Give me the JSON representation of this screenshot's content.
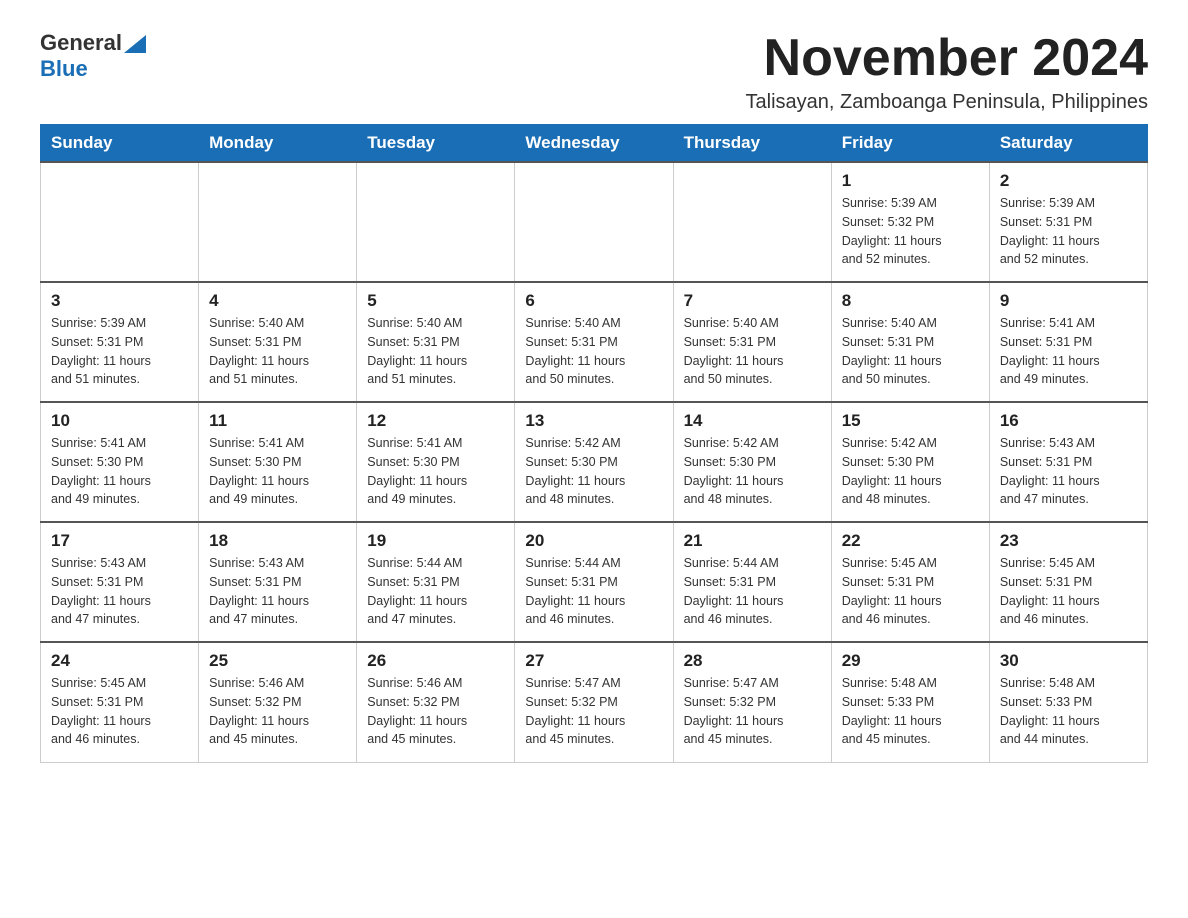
{
  "header": {
    "logo_general": "General",
    "logo_blue": "Blue",
    "month_title": "November 2024",
    "location": "Talisayan, Zamboanga Peninsula, Philippines"
  },
  "weekdays": [
    "Sunday",
    "Monday",
    "Tuesday",
    "Wednesday",
    "Thursday",
    "Friday",
    "Saturday"
  ],
  "weeks": [
    [
      {
        "day": "",
        "info": ""
      },
      {
        "day": "",
        "info": ""
      },
      {
        "day": "",
        "info": ""
      },
      {
        "day": "",
        "info": ""
      },
      {
        "day": "",
        "info": ""
      },
      {
        "day": "1",
        "info": "Sunrise: 5:39 AM\nSunset: 5:32 PM\nDaylight: 11 hours\nand 52 minutes."
      },
      {
        "day": "2",
        "info": "Sunrise: 5:39 AM\nSunset: 5:31 PM\nDaylight: 11 hours\nand 52 minutes."
      }
    ],
    [
      {
        "day": "3",
        "info": "Sunrise: 5:39 AM\nSunset: 5:31 PM\nDaylight: 11 hours\nand 51 minutes."
      },
      {
        "day": "4",
        "info": "Sunrise: 5:40 AM\nSunset: 5:31 PM\nDaylight: 11 hours\nand 51 minutes."
      },
      {
        "day": "5",
        "info": "Sunrise: 5:40 AM\nSunset: 5:31 PM\nDaylight: 11 hours\nand 51 minutes."
      },
      {
        "day": "6",
        "info": "Sunrise: 5:40 AM\nSunset: 5:31 PM\nDaylight: 11 hours\nand 50 minutes."
      },
      {
        "day": "7",
        "info": "Sunrise: 5:40 AM\nSunset: 5:31 PM\nDaylight: 11 hours\nand 50 minutes."
      },
      {
        "day": "8",
        "info": "Sunrise: 5:40 AM\nSunset: 5:31 PM\nDaylight: 11 hours\nand 50 minutes."
      },
      {
        "day": "9",
        "info": "Sunrise: 5:41 AM\nSunset: 5:31 PM\nDaylight: 11 hours\nand 49 minutes."
      }
    ],
    [
      {
        "day": "10",
        "info": "Sunrise: 5:41 AM\nSunset: 5:30 PM\nDaylight: 11 hours\nand 49 minutes."
      },
      {
        "day": "11",
        "info": "Sunrise: 5:41 AM\nSunset: 5:30 PM\nDaylight: 11 hours\nand 49 minutes."
      },
      {
        "day": "12",
        "info": "Sunrise: 5:41 AM\nSunset: 5:30 PM\nDaylight: 11 hours\nand 49 minutes."
      },
      {
        "day": "13",
        "info": "Sunrise: 5:42 AM\nSunset: 5:30 PM\nDaylight: 11 hours\nand 48 minutes."
      },
      {
        "day": "14",
        "info": "Sunrise: 5:42 AM\nSunset: 5:30 PM\nDaylight: 11 hours\nand 48 minutes."
      },
      {
        "day": "15",
        "info": "Sunrise: 5:42 AM\nSunset: 5:30 PM\nDaylight: 11 hours\nand 48 minutes."
      },
      {
        "day": "16",
        "info": "Sunrise: 5:43 AM\nSunset: 5:31 PM\nDaylight: 11 hours\nand 47 minutes."
      }
    ],
    [
      {
        "day": "17",
        "info": "Sunrise: 5:43 AM\nSunset: 5:31 PM\nDaylight: 11 hours\nand 47 minutes."
      },
      {
        "day": "18",
        "info": "Sunrise: 5:43 AM\nSunset: 5:31 PM\nDaylight: 11 hours\nand 47 minutes."
      },
      {
        "day": "19",
        "info": "Sunrise: 5:44 AM\nSunset: 5:31 PM\nDaylight: 11 hours\nand 47 minutes."
      },
      {
        "day": "20",
        "info": "Sunrise: 5:44 AM\nSunset: 5:31 PM\nDaylight: 11 hours\nand 46 minutes."
      },
      {
        "day": "21",
        "info": "Sunrise: 5:44 AM\nSunset: 5:31 PM\nDaylight: 11 hours\nand 46 minutes."
      },
      {
        "day": "22",
        "info": "Sunrise: 5:45 AM\nSunset: 5:31 PM\nDaylight: 11 hours\nand 46 minutes."
      },
      {
        "day": "23",
        "info": "Sunrise: 5:45 AM\nSunset: 5:31 PM\nDaylight: 11 hours\nand 46 minutes."
      }
    ],
    [
      {
        "day": "24",
        "info": "Sunrise: 5:45 AM\nSunset: 5:31 PM\nDaylight: 11 hours\nand 46 minutes."
      },
      {
        "day": "25",
        "info": "Sunrise: 5:46 AM\nSunset: 5:32 PM\nDaylight: 11 hours\nand 45 minutes."
      },
      {
        "day": "26",
        "info": "Sunrise: 5:46 AM\nSunset: 5:32 PM\nDaylight: 11 hours\nand 45 minutes."
      },
      {
        "day": "27",
        "info": "Sunrise: 5:47 AM\nSunset: 5:32 PM\nDaylight: 11 hours\nand 45 minutes."
      },
      {
        "day": "28",
        "info": "Sunrise: 5:47 AM\nSunset: 5:32 PM\nDaylight: 11 hours\nand 45 minutes."
      },
      {
        "day": "29",
        "info": "Sunrise: 5:48 AM\nSunset: 5:33 PM\nDaylight: 11 hours\nand 45 minutes."
      },
      {
        "day": "30",
        "info": "Sunrise: 5:48 AM\nSunset: 5:33 PM\nDaylight: 11 hours\nand 44 minutes."
      }
    ]
  ]
}
